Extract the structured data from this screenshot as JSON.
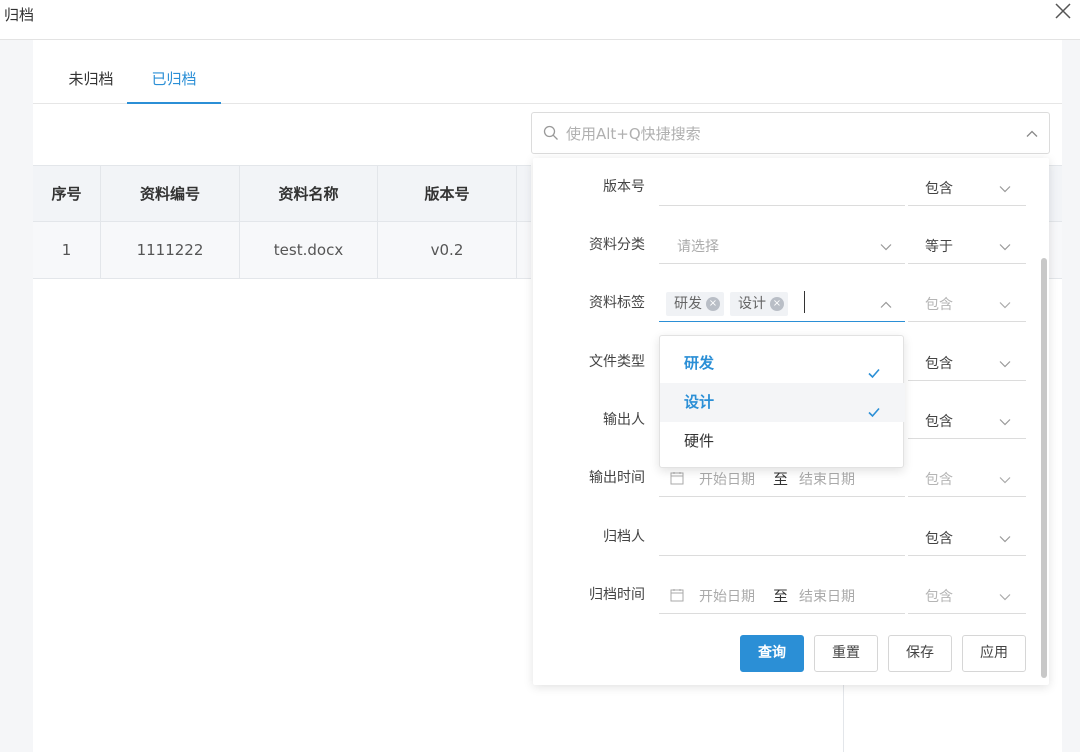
{
  "window": {
    "title": "归档"
  },
  "tabs": [
    {
      "label": "未归档"
    },
    {
      "label": "已归档"
    }
  ],
  "search": {
    "placeholder": "使用Alt+Q快捷搜索"
  },
  "table": {
    "headers": [
      "序号",
      "资料编号",
      "资料名称",
      "版本号"
    ],
    "rows": [
      [
        "1",
        "1111222",
        "test.docx",
        "v0.2"
      ]
    ]
  },
  "filter": {
    "rows": [
      {
        "label": "版本号",
        "value": "",
        "operator": "包含"
      },
      {
        "label": "资料分类",
        "placeholder": "请选择",
        "operator": "等于"
      },
      {
        "label": "资料标签",
        "tags": [
          "研发",
          "设计"
        ],
        "operator": "包含"
      },
      {
        "label": "文件类型",
        "operator": "包含"
      },
      {
        "label": "输出人",
        "operator": "包含"
      },
      {
        "label": "输出时间",
        "start": "开始日期",
        "to": "至",
        "end": "结束日期",
        "operator": "包含"
      },
      {
        "label": "归档人",
        "operator": "包含"
      },
      {
        "label": "归档时间",
        "start": "开始日期",
        "to": "至",
        "end": "结束日期",
        "operator": "包含"
      }
    ],
    "buttons": {
      "query": "查询",
      "reset": "重置",
      "save": "保存",
      "apply": "应用"
    }
  },
  "tag_dropdown": {
    "options": [
      {
        "label": "研发",
        "selected": true
      },
      {
        "label": "设计",
        "selected": true
      },
      {
        "label": "硬件",
        "selected": false
      }
    ]
  },
  "colors": {
    "accent": "#2b8fd6",
    "header_bg": "#f2f4f7"
  },
  "icons": [
    "close-icon",
    "search-icon",
    "chevron-down-icon",
    "chevron-up-icon",
    "calendar-icon",
    "check-icon",
    "tag-remove-icon"
  ]
}
